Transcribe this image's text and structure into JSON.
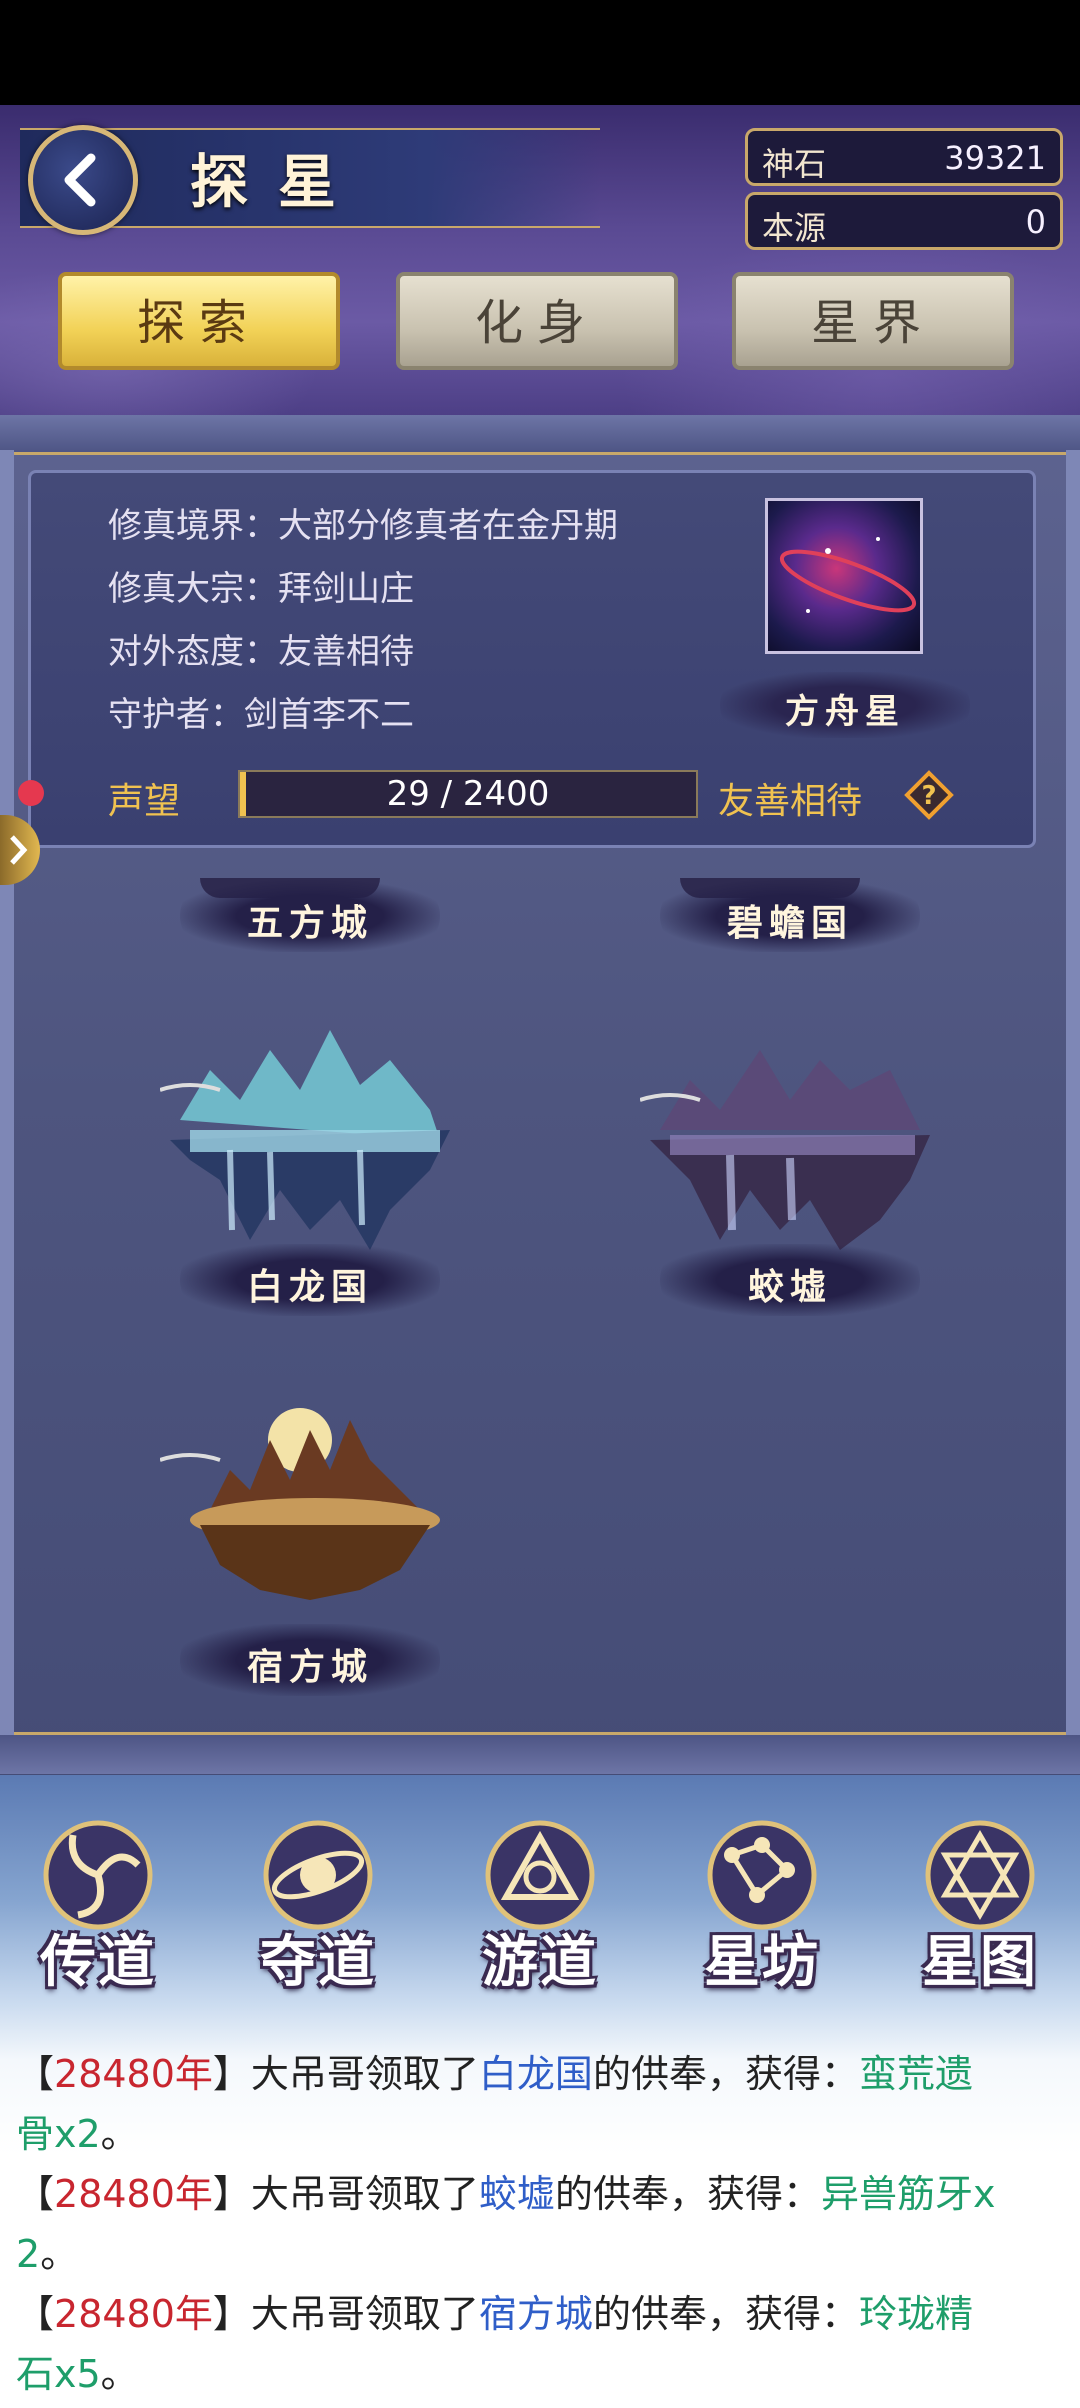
{
  "header": {
    "title": "探星",
    "resources": [
      {
        "label": "神石",
        "value": "39321"
      },
      {
        "label": "本源",
        "value": "0"
      }
    ],
    "tabs": [
      {
        "label": "探索",
        "active": true
      },
      {
        "label": "化身",
        "active": false
      },
      {
        "label": "星界",
        "active": false
      }
    ]
  },
  "info": {
    "lines": [
      "修真境界：大部分修真者在金丹期",
      "修真大宗：拜剑山庄",
      "对外态度：友善相待",
      "守护者：剑首李不二"
    ],
    "planet_name": "方舟星",
    "reputation": {
      "label": "声望",
      "current": 29,
      "max": 2400,
      "text": "29 / 2400",
      "status": "友善相待"
    }
  },
  "cities": [
    {
      "name": "五方城"
    },
    {
      "name": "碧蟾国"
    },
    {
      "name": "白龙国"
    },
    {
      "name": "蛟墟"
    },
    {
      "name": "宿方城"
    }
  ],
  "nav": [
    {
      "label": "传道",
      "icon": "swirl-icon"
    },
    {
      "label": "夺道",
      "icon": "orbit-icon"
    },
    {
      "label": "游道",
      "icon": "triangle-rings-icon"
    },
    {
      "label": "星坊",
      "icon": "constellation-icon"
    },
    {
      "label": "星图",
      "icon": "star-of-david-icon"
    }
  ],
  "log": [
    {
      "year": "28480年",
      "text1": "】大吊哥领取了",
      "place": "白龙国",
      "text2": "的供奉，获得：",
      "item_a": "蛮荒遗",
      "item_b": "骨x2",
      "end": "。"
    },
    {
      "year": "28480年",
      "text1": "】大吊哥领取了",
      "place": "蛟墟",
      "text2": "的供奉，获得：",
      "item_a": "异兽筋牙x",
      "item_b": "2",
      "end": "。"
    },
    {
      "year": "28480年",
      "text1": "】大吊哥领取了",
      "place": "宿方城",
      "text2": "的供奉，获得：",
      "item_a": "玲珑精",
      "item_b": "石x5",
      "end": "。"
    }
  ],
  "colors": {
    "accent_gold": "#f0c250",
    "year_red": "#c8262f",
    "place_blue": "#2f5ec8",
    "item_green": "#1e9e6a"
  }
}
